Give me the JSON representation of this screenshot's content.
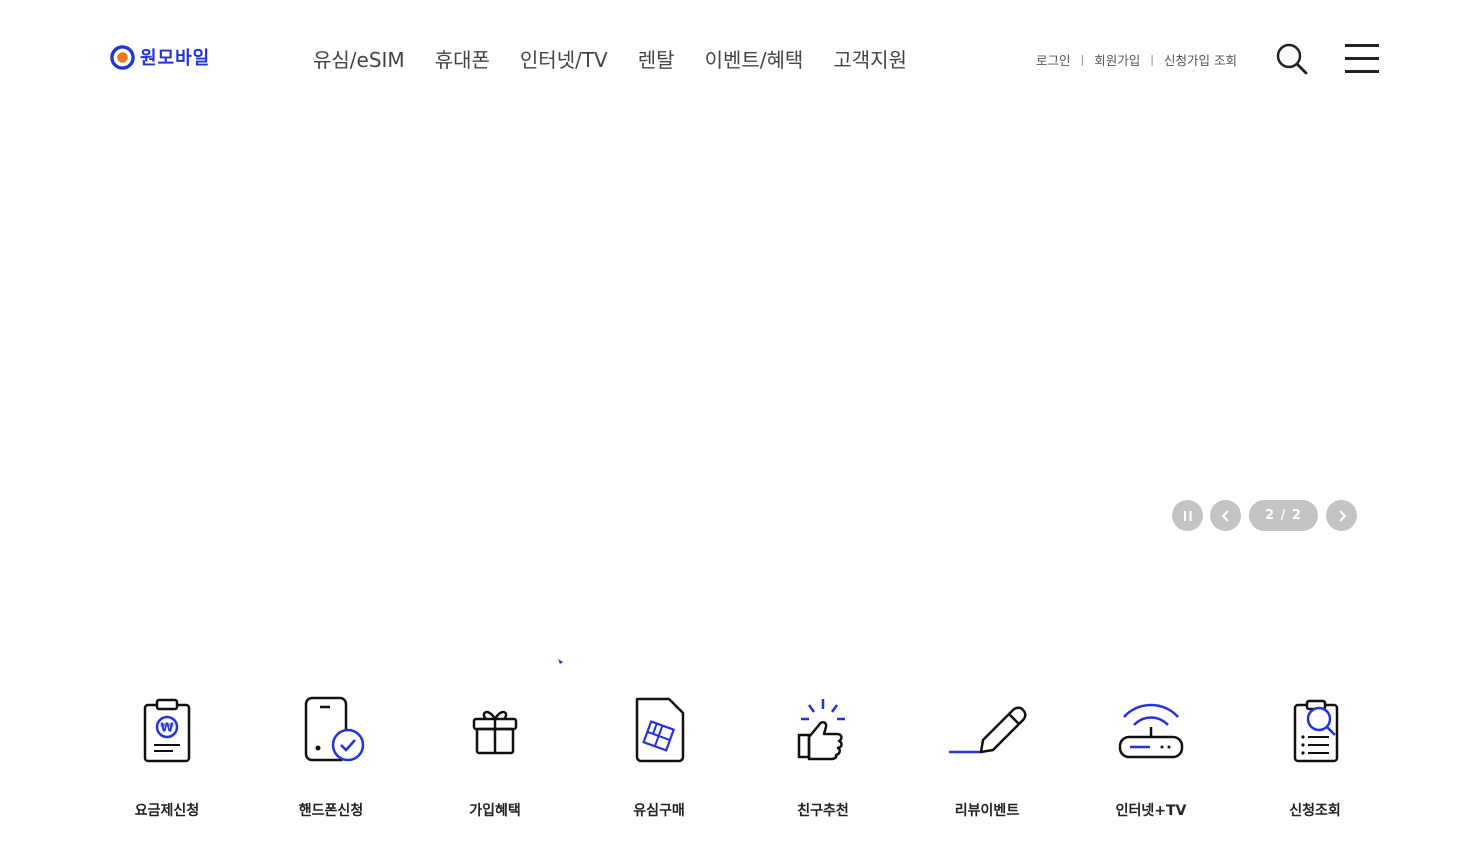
{
  "brand": {
    "name": "원모바일",
    "accent": "#2433d8",
    "logo_ring_outer": "#2433d8",
    "logo_ring_inner": "#e87a1c"
  },
  "gnb": [
    "유심/eSIM",
    "휴대폰",
    "인터넷/TV",
    "렌탈",
    "이벤트/혜택",
    "고객지원"
  ],
  "util": {
    "login": "로그인",
    "join": "회원가입",
    "apply_check": "신청가입 조회",
    "separator": "|"
  },
  "header_icons": {
    "search": "search-icon",
    "menu": "hamburger-menu-icon"
  },
  "slider": {
    "pager": "2 / 2",
    "pause_icon": "pause-icon",
    "prev_icon": "chevron-left-icon",
    "next_icon": "chevron-right-icon",
    "control_color": "#c4c4c4"
  },
  "quick_menu": [
    {
      "label": "요금제신청",
      "icon": "clipboard-won-icon"
    },
    {
      "label": "핸드폰신청",
      "icon": "phone-check-icon"
    },
    {
      "label": "가입혜택",
      "icon": "gift-icon"
    },
    {
      "label": "유심구매",
      "icon": "sim-card-icon"
    },
    {
      "label": "친구추천",
      "icon": "thumbs-up-icon"
    },
    {
      "label": "리뷰이벤트",
      "icon": "pencil-icon"
    },
    {
      "label": "인터넷+TV",
      "icon": "router-wifi-icon"
    },
    {
      "label": "신청조회",
      "icon": "document-search-icon"
    }
  ]
}
